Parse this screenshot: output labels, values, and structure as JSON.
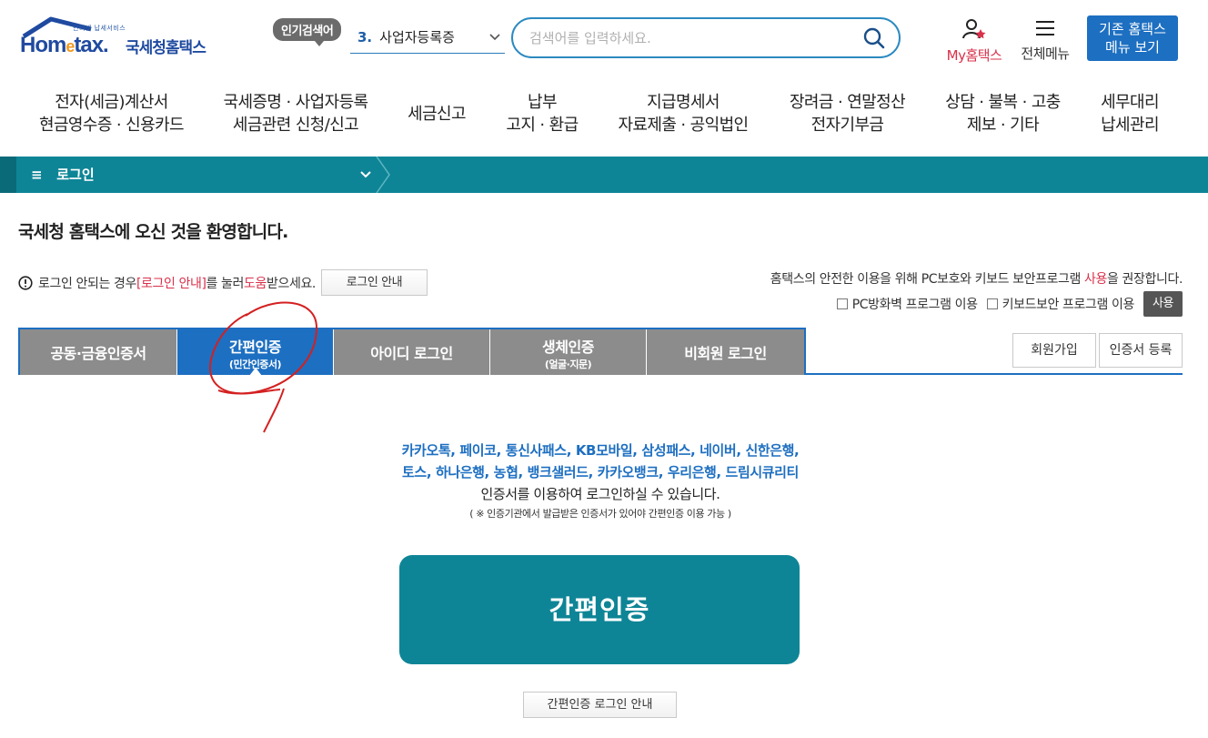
{
  "header": {
    "logo_small": "인터넷 납세서비스",
    "logo_word_a": "Hom",
    "logo_word_e": "e",
    "logo_word_b": "tax.",
    "logo_sub": "국세청홈택스",
    "hot_badge": "인기검색어",
    "hot_number": "3.",
    "hot_keyword": "사업자등록증",
    "search_placeholder": "검색어를 입력하세요.",
    "my_hometax": "My홈택스",
    "all_menu": "전체메뉴",
    "old_line1": "기존 홈택스",
    "old_line2": "메뉴 보기"
  },
  "gnb": [
    {
      "l1": "전자(세금)계산서",
      "l2": "현금영수증 · 신용카드"
    },
    {
      "l1": "국세증명 · 사업자등록",
      "l2": "세금관련 신청/신고"
    },
    {
      "l1": "세금신고",
      "l2": ""
    },
    {
      "l1": "납부",
      "l2": "고지 · 환급"
    },
    {
      "l1": "지급명세서",
      "l2": "자료제출 · 공익법인"
    },
    {
      "l1": "장려금 · 연말정산",
      "l2": "전자기부금"
    },
    {
      "l1": "상담 · 불복 · 고충",
      "l2": "제보 · 기타"
    },
    {
      "l1": "세무대리",
      "l2": "납세관리"
    }
  ],
  "location": {
    "menu_glyph": "≡",
    "current": "로그인"
  },
  "welcome": "국세청 홈택스에 오신 것을 환영합니다.",
  "notice": {
    "a": "로그인 안되는 경우 ",
    "b": "[로그인 안내]",
    "c": "를 눌러 ",
    "d": "도움",
    "e": "받으세요.",
    "button": "로그인 안내"
  },
  "secure": {
    "a": "홈택스의 안전한 이용을 위해 PC보호와 키보드 보안프로그램 ",
    "b": "사용",
    "c": "을 권장합니다.",
    "opt1": "PC방화벽 프로그램 이용",
    "opt2": "키보드보안 프로그램 이용",
    "use_button": "사용"
  },
  "tabs": [
    {
      "t1": "공동·금융인증서",
      "t2": ""
    },
    {
      "t1": "간편인증",
      "t2": "(민간인증서)"
    },
    {
      "t1": "아이디 로그인",
      "t2": ""
    },
    {
      "t1": "생체인증",
      "t2": "(얼굴·지문)"
    },
    {
      "t1": "비회원 로그인",
      "t2": ""
    }
  ],
  "side_buttons": {
    "join": "회원가입",
    "cert": "인증서 등록"
  },
  "desc": {
    "line1": "카카오톡, 페이코, 통신사패스, KB모바일, 삼성패스, 네이버, 신한은행,",
    "line2": "토스, 하나은행, 농협, 뱅크샐러드, 카카오뱅크, 우리은행, 드림시큐리티",
    "line3": "인증서를 이용하여 로그인하실 수 있습니다.",
    "note": "( ※ 인증기관에서 발급받은 인증서가 있어야 간편인증 이용 가능 )"
  },
  "main_button": "간편인증",
  "guide_button": "간편인증 로그인 안내"
}
